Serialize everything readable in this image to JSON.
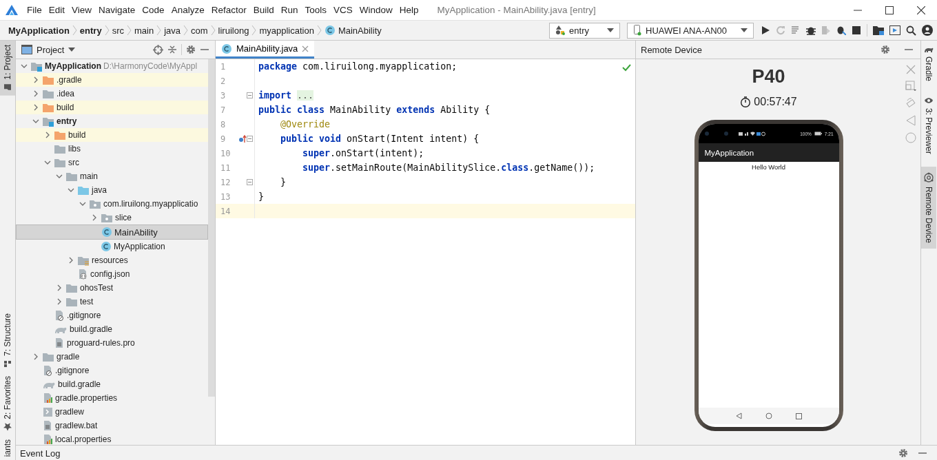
{
  "title_bar": {
    "menus": [
      "File",
      "Edit",
      "View",
      "Navigate",
      "Code",
      "Analyze",
      "Refactor",
      "Build",
      "Run",
      "Tools",
      "VCS",
      "Window",
      "Help"
    ],
    "title": "MyApplication - MainAbility.java [entry]"
  },
  "navigation_bar": {
    "breadcrumbs": [
      {
        "label": "MyApplication",
        "kind": "module"
      },
      {
        "label": "entry",
        "kind": "module"
      },
      {
        "label": "src",
        "kind": "folder"
      },
      {
        "label": "main",
        "kind": "folder"
      },
      {
        "label": "java",
        "kind": "folder"
      },
      {
        "label": "com",
        "kind": "folder"
      },
      {
        "label": "liruilong",
        "kind": "folder"
      },
      {
        "label": "myapplication",
        "kind": "folder"
      },
      {
        "label": "MainAbility",
        "kind": "class"
      }
    ],
    "run_configuration": "entry",
    "device": "HUAWEI ANA-AN00"
  },
  "left_tool_strip": [
    {
      "label": "1: Project",
      "selected": true
    },
    {
      "label": "7: Structure",
      "selected": false
    },
    {
      "label": "2: Favorites",
      "selected": false
    },
    {
      "label": "iants",
      "selected": false
    }
  ],
  "project_panel": {
    "title": "Project",
    "tree": [
      {
        "label": "MyApplication",
        "path": "D:\\HarmonyCode\\MyAppl",
        "kind": "module",
        "expanded": true,
        "selected": false,
        "children": [
          {
            "label": ".gradle",
            "kind": "excluded",
            "expanded": false,
            "selected": false
          },
          {
            "label": ".idea",
            "kind": "folder",
            "expanded": false,
            "selected": false
          },
          {
            "label": "build",
            "kind": "excluded",
            "expanded": false,
            "selected": false
          },
          {
            "label": "entry",
            "kind": "module",
            "expanded": true,
            "selected": false,
            "children": [
              {
                "label": "build",
                "kind": "excluded",
                "expanded": false,
                "selected": false
              },
              {
                "label": "libs",
                "kind": "folder",
                "selected": false
              },
              {
                "label": "src",
                "kind": "folder",
                "expanded": true,
                "selected": false,
                "children": [
                  {
                    "label": "main",
                    "kind": "folder",
                    "expanded": true,
                    "selected": false,
                    "children": [
                      {
                        "label": "java",
                        "kind": "source",
                        "expanded": true,
                        "selected": false,
                        "children": [
                          {
                            "label": "com.liruilong.myapplicatio",
                            "kind": "package",
                            "expanded": true,
                            "selected": false,
                            "children": [
                              {
                                "label": "slice",
                                "kind": "package",
                                "expanded": false,
                                "selected": false
                              },
                              {
                                "label": "MainAbility",
                                "kind": "class",
                                "selected": true
                              },
                              {
                                "label": "MyApplication",
                                "kind": "class",
                                "selected": false
                              }
                            ]
                          }
                        ]
                      },
                      {
                        "label": "resources",
                        "kind": "resources",
                        "expanded": false,
                        "selected": false
                      },
                      {
                        "label": "config.json",
                        "kind": "json",
                        "selected": false
                      }
                    ]
                  },
                  {
                    "label": "ohosTest",
                    "kind": "folder",
                    "expanded": false,
                    "selected": false
                  },
                  {
                    "label": "test",
                    "kind": "folder",
                    "expanded": false,
                    "selected": false
                  }
                ]
              },
              {
                "label": ".gitignore",
                "kind": "ignore",
                "selected": false
              },
              {
                "label": "build.gradle",
                "kind": "gradle",
                "selected": false
              },
              {
                "label": "proguard-rules.pro",
                "kind": "text",
                "selected": false
              }
            ]
          },
          {
            "label": "gradle",
            "kind": "folder",
            "expanded": false,
            "selected": false
          },
          {
            "label": ".gitignore",
            "kind": "ignore",
            "selected": false
          },
          {
            "label": "build.gradle",
            "kind": "gradle",
            "selected": false
          },
          {
            "label": "gradle.properties",
            "kind": "properties",
            "selected": false
          },
          {
            "label": "gradlew",
            "kind": "script",
            "selected": false
          },
          {
            "label": "gradlew.bat",
            "kind": "text",
            "selected": false
          },
          {
            "label": "local.properties",
            "kind": "properties",
            "selected": false
          }
        ]
      }
    ]
  },
  "editor": {
    "tabs": [
      {
        "label": "MainAbility.java",
        "selected": true
      }
    ],
    "lines": [
      {
        "number": "1",
        "fold": false,
        "override_marker": false,
        "current": false,
        "tokens": [
          {
            "text": "package",
            "kind": "keyword"
          },
          {
            "text": " com.liruilong.myapplication;",
            "kind": "plain"
          }
        ]
      },
      {
        "number": "2",
        "fold": false,
        "override_marker": false,
        "current": false
      },
      {
        "number": "3",
        "fold": true,
        "override_marker": false,
        "current": false,
        "tokens": [
          {
            "text": "import ",
            "kind": "keyword"
          },
          {
            "text": "...",
            "kind": "folded"
          }
        ]
      },
      {
        "number": "7",
        "fold": false,
        "override_marker": false,
        "current": false,
        "tokens": [
          {
            "text": "public class",
            "kind": "keyword"
          },
          {
            "text": " MainAbility ",
            "kind": "plain"
          },
          {
            "text": "extends",
            "kind": "keyword"
          },
          {
            "text": " Ability {",
            "kind": "plain"
          }
        ]
      },
      {
        "number": "8",
        "fold": false,
        "override_marker": false,
        "current": false,
        "tokens": [
          {
            "text": "    @Override",
            "kind": "annotation"
          }
        ]
      },
      {
        "number": "9",
        "fold": true,
        "override_marker": true,
        "current": false,
        "tokens": [
          {
            "text": "    public void",
            "kind": "keyword"
          },
          {
            "text": " onStart(Intent intent) {",
            "kind": "plain"
          }
        ]
      },
      {
        "number": "10",
        "fold": false,
        "override_marker": false,
        "current": false,
        "tokens": [
          {
            "text": "        super",
            "kind": "keyword"
          },
          {
            "text": ".onStart(intent);",
            "kind": "plain"
          }
        ]
      },
      {
        "number": "11",
        "fold": false,
        "override_marker": false,
        "current": false,
        "tokens": [
          {
            "text": "        super",
            "kind": "keyword"
          },
          {
            "text": ".setMainRoute(MainAbilitySlice.",
            "kind": "plain"
          },
          {
            "text": "class",
            "kind": "keyword"
          },
          {
            "text": ".getName());",
            "kind": "plain"
          }
        ]
      },
      {
        "number": "12",
        "fold": true,
        "override_marker": false,
        "current": false,
        "tokens": [
          {
            "text": "    }",
            "kind": "plain"
          }
        ]
      },
      {
        "number": "13",
        "fold": false,
        "override_marker": false,
        "current": false,
        "tokens": [
          {
            "text": "}",
            "kind": "plain"
          }
        ]
      },
      {
        "number": "14",
        "fold": false,
        "override_marker": false,
        "current": true
      }
    ]
  },
  "remote_device": {
    "title": "Remote Device",
    "model": "P40",
    "timer": "00:57:47",
    "phone": {
      "status_battery": "100%",
      "status_time": "7:21",
      "app_title": "MyApplication",
      "content": "Hello World"
    }
  },
  "right_tool_strip": [
    {
      "label": "Gradle",
      "selected": false
    },
    {
      "label": "3: Previewer",
      "selected": false
    },
    {
      "label": "Remote Device",
      "selected": true
    }
  ],
  "bottom_bar": {
    "label": "Event Log"
  }
}
